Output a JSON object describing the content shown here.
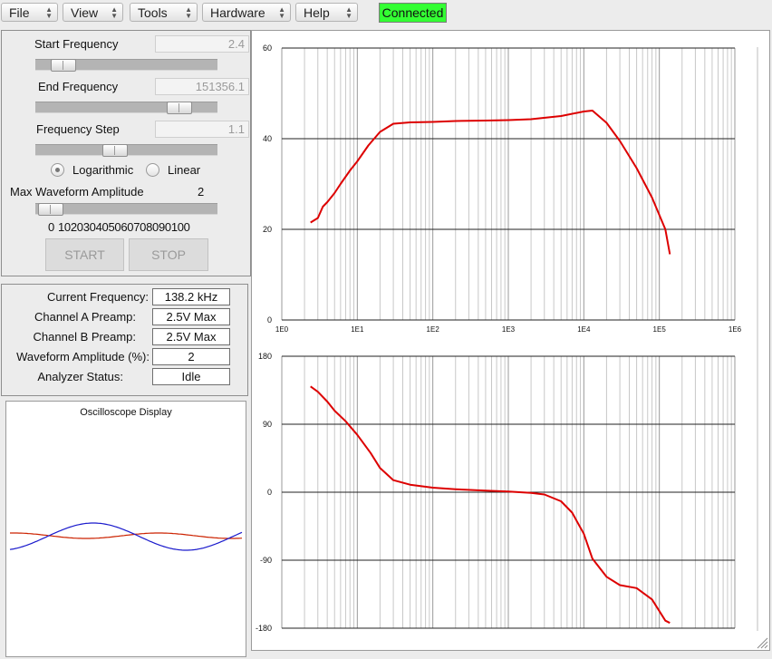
{
  "menubar": {
    "items": [
      {
        "label": "File"
      },
      {
        "label": "View"
      },
      {
        "label": "Tools"
      },
      {
        "label": "Hardware"
      },
      {
        "label": "Help"
      }
    ],
    "status": "Connected",
    "status_color": "#33ff33"
  },
  "controls": {
    "start_frequency": {
      "label": "Start Frequency",
      "value": "2.4",
      "slider_level": 0.1
    },
    "end_frequency": {
      "label": "End Frequency",
      "value": "151356.1",
      "slider_level": 0.85
    },
    "frequency_step": {
      "label": "Frequency Step",
      "value": "1.1",
      "slider_level": 0.43
    },
    "scale": {
      "logarithmic_label": "Logarithmic",
      "linear_label": "Linear",
      "selected": "Logarithmic"
    },
    "amplitude": {
      "label": "Max Waveform Amplitude",
      "value": "2",
      "slider_level": 0.02,
      "ticks": [
        "0",
        "10",
        "20",
        "30",
        "40",
        "50",
        "60",
        "70",
        "80",
        "90",
        "100"
      ]
    },
    "start_label": "START",
    "stop_label": "STOP"
  },
  "info": [
    {
      "label": "Current Frequency:",
      "value": "138.2 kHz"
    },
    {
      "label": "Channel A Preamp:",
      "value": "2.5V Max"
    },
    {
      "label": "Channel B Preamp:",
      "value": "2.5V Max"
    },
    {
      "label": "Waveform Amplitude (%):",
      "value": "2"
    },
    {
      "label": "Analyzer Status:",
      "value": "Idle"
    }
  ],
  "oscilloscope": {
    "title": "Oscilloscope Display",
    "channel_a_color": "#cc2200",
    "channel_b_color": "#1a1acc"
  },
  "chart_data": [
    {
      "type": "line",
      "xscale": "log",
      "xlim": [
        1,
        1000000
      ],
      "ylim": [
        0,
        60
      ],
      "yticks": [
        "0",
        "20",
        "40",
        "60"
      ],
      "xticks": [
        "1E0",
        "1E1",
        "1E2",
        "1E3",
        "1E4",
        "1E5",
        "1E6"
      ],
      "grid": true,
      "color": "#dd0000",
      "series": [
        {
          "x": [
            2.4,
            3,
            3.5,
            4,
            5,
            6,
            8,
            10,
            14,
            20,
            30,
            50,
            100,
            200,
            500,
            1000,
            2000,
            5000,
            10000,
            13000,
            20000,
            30000,
            50000,
            80000,
            120000,
            138000
          ],
          "y": [
            21.5,
            22.5,
            25,
            26,
            28,
            30,
            33,
            35,
            38.5,
            41.5,
            43.3,
            43.6,
            43.7,
            43.9,
            44,
            44.1,
            44.3,
            45,
            46,
            46.2,
            43.5,
            39.5,
            33.5,
            27,
            20,
            14.5
          ]
        }
      ]
    },
    {
      "type": "line",
      "xscale": "log",
      "xlim": [
        1,
        1000000
      ],
      "ylim": [
        -180,
        180
      ],
      "yticks": [
        "-180",
        "-90",
        "0",
        "90",
        "180"
      ],
      "xticks": [],
      "grid": true,
      "color": "#dd0000",
      "series": [
        {
          "x": [
            2.4,
            3,
            4,
            5,
            7,
            10,
            15,
            20,
            30,
            50,
            100,
            200,
            500,
            1000,
            2000,
            3000,
            5000,
            7000,
            10000,
            13000,
            20000,
            30000,
            50000,
            80000,
            120000,
            138000
          ],
          "y": [
            140,
            133,
            120,
            108,
            94,
            76,
            52,
            32,
            16,
            10,
            6,
            4,
            2,
            1,
            -1,
            -3,
            -12,
            -27,
            -55,
            -88,
            -112,
            -123,
            -127,
            -142,
            -170,
            -173
          ]
        }
      ]
    }
  ]
}
